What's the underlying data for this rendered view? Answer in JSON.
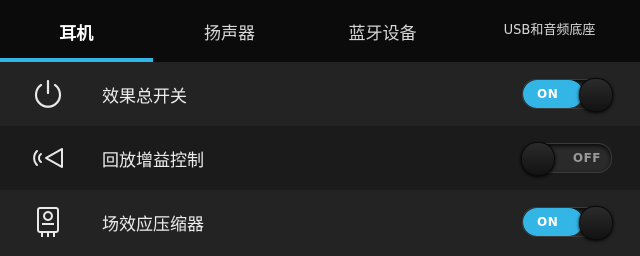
{
  "tabs": [
    {
      "label": "耳机"
    },
    {
      "label": "扬声器"
    },
    {
      "label": "蓝牙设备"
    },
    {
      "label": "USB和音频底座"
    }
  ],
  "accent_color": "#33b5e5",
  "rows": [
    {
      "icon": "power-icon",
      "label": "效果总开关",
      "toggle_state": "ON"
    },
    {
      "icon": "speaker-gain-icon",
      "label": "回放增益控制",
      "toggle_state": "OFF"
    },
    {
      "icon": "compressor-chip-icon",
      "label": "场效应压缩器",
      "toggle_state": "ON"
    }
  ]
}
